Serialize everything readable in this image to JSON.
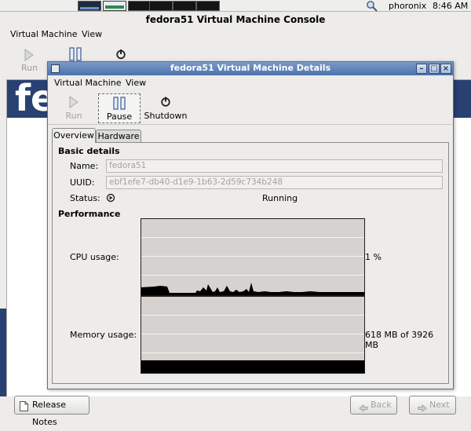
{
  "panel": {
    "user": "phoronix",
    "clock": "8:46 AM"
  },
  "console": {
    "title": "fedora51 Virtual Machine Console",
    "menu": [
      "Virtual Machine",
      "View"
    ],
    "toolbar": {
      "run_label": "Run"
    },
    "banner_text": "fe",
    "bottom_buttons": {
      "release_notes": "Release Notes",
      "back": "Back",
      "next": "Next"
    }
  },
  "details": {
    "title": "fedora51 Virtual Machine Details",
    "menu": [
      "Virtual Machine",
      "View"
    ],
    "toolbar": {
      "run": "Run",
      "pause": "Pause",
      "shutdown": "Shutdown"
    },
    "tabs": [
      "Overview",
      "Hardware"
    ],
    "active_tab": "Overview",
    "basic_details": {
      "title": "Basic details",
      "name_label": "Name:",
      "name_value": "fedora51",
      "uuid_label": "UUID:",
      "uuid_value": "ebf1efe7-db40-d1e9-1b63-2d59c734b248",
      "status_label": "Status:",
      "status_value": "Running"
    },
    "performance": {
      "title": "Performance",
      "cpu_label": "CPU usage:",
      "cpu_value": "1 %",
      "memory_label": "Memory usage:",
      "memory_value": "618 MB of 3926 MB"
    }
  },
  "colors": {
    "titlebar_active": "#4d73ae",
    "graph_bg": "#d6d2cf",
    "graph_fill": "#000000",
    "fedora_blue": "#294172"
  }
}
